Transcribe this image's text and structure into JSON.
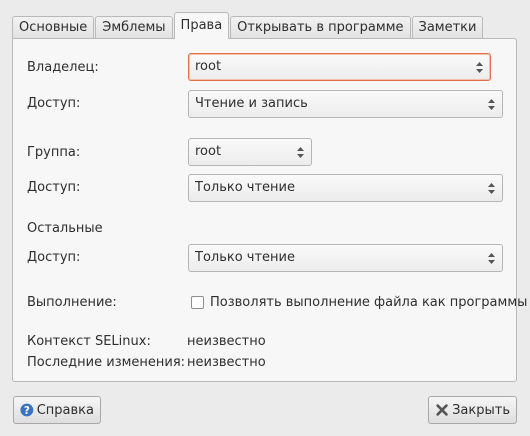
{
  "tabs": [
    "Основные",
    "Эмблемы",
    "Права",
    "Открывать в программе",
    "Заметки"
  ],
  "owner": {
    "label": "Владелец:",
    "value": "root"
  },
  "owner_access": {
    "label": "Доступ:",
    "value": "Чтение и запись"
  },
  "group": {
    "label": "Группа:",
    "value": "root"
  },
  "group_access": {
    "label": "Доступ:",
    "value": "Только чтение"
  },
  "others": {
    "heading": "Остальные",
    "access_label": "Доступ:",
    "access_value": "Только чтение"
  },
  "execute": {
    "label": "Выполнение:",
    "checkbox_label": "Позволять выполнение файла как программы",
    "checked": false
  },
  "selinux": {
    "label": "Контекст SELinux:",
    "value": "неизвестно"
  },
  "modified": {
    "label": "Последние изменения:",
    "value": "неизвестно"
  },
  "buttons": {
    "help": "Справка",
    "close": "Закрыть"
  },
  "colors": {
    "focus_border": "#e2704a",
    "help_icon": "#3a73c2",
    "close_icon": "#555555"
  }
}
